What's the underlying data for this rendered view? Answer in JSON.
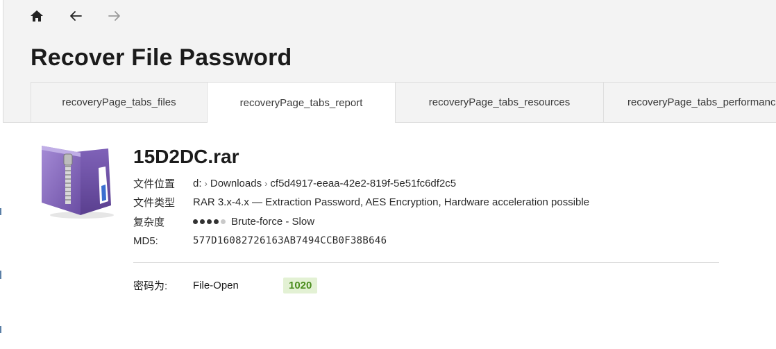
{
  "nav": {
    "home_icon": "home-icon",
    "back_icon": "arrow-left-icon",
    "forward_icon": "arrow-right-icon"
  },
  "page": {
    "title": "Recover File Password"
  },
  "tabs": [
    {
      "label": "recoveryPage_tabs_files",
      "active": false
    },
    {
      "label": "recoveryPage_tabs_report",
      "active": true
    },
    {
      "label": "recoveryPage_tabs_resources",
      "active": false
    },
    {
      "label": "recoveryPage_tabs_performance",
      "active": false
    }
  ],
  "file": {
    "name": "15D2DC.rar",
    "icon": "zip-folder-icon",
    "location_label": "文件位置",
    "location": {
      "drive": "d:",
      "folder": "Downloads",
      "subfolder": "cf5d4917-eeaa-42e2-819f-5e51fc6df2c5"
    },
    "type_label": "文件类型",
    "type": "RAR 3.x-4.x — Extraction Password, AES Encryption, Hardware acceleration possible",
    "complexity_label": "复杂度",
    "complexity_level": 4,
    "complexity_max": 5,
    "complexity_text": "Brute-force - Slow",
    "md5_label": "MD5:",
    "md5": "577D16082726163AB7494CCB0F38B646"
  },
  "password": {
    "label": "密码为:",
    "type": "File-Open",
    "value": "1020"
  },
  "colors": {
    "badge_bg": "#e3f1d4",
    "badge_text": "#4a8c1c",
    "icon_purple": "#8a6bc0"
  }
}
